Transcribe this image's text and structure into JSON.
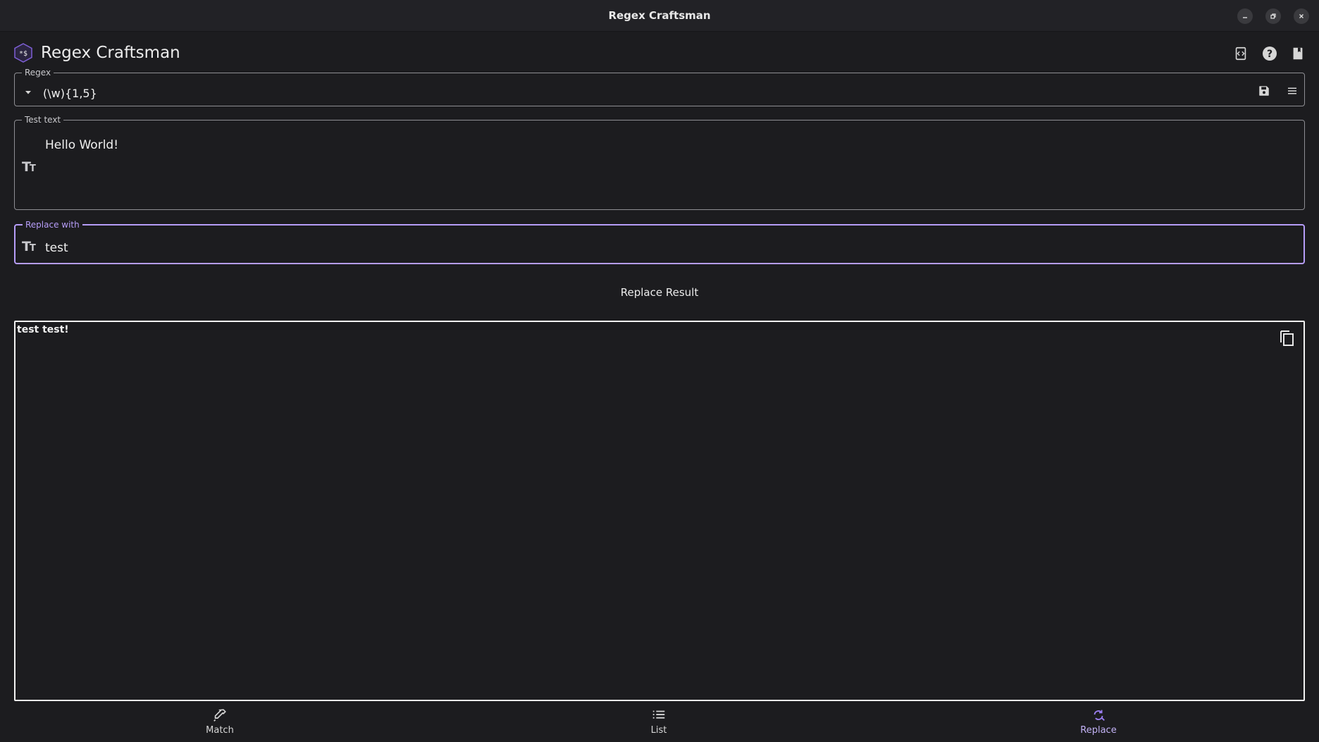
{
  "window": {
    "title": "Regex Craftsman"
  },
  "app": {
    "title": "Regex Craftsman"
  },
  "regex": {
    "legend": "Regex",
    "value": "(\\w){1,5}"
  },
  "test_text": {
    "legend": "Test text",
    "value": "Hello World!"
  },
  "replace_with": {
    "legend": "Replace with",
    "value": "test"
  },
  "result": {
    "heading": "Replace Result",
    "value": "test test!"
  },
  "nav": {
    "items": [
      {
        "label": "Match",
        "icon": "eyedropper-icon"
      },
      {
        "label": "List",
        "icon": "list-icon"
      },
      {
        "label": "Replace",
        "icon": "find-replace-icon",
        "active": true
      }
    ]
  },
  "colors": {
    "accent": "#b69df8",
    "background": "#1c1c1f",
    "titlebar": "#222226"
  }
}
